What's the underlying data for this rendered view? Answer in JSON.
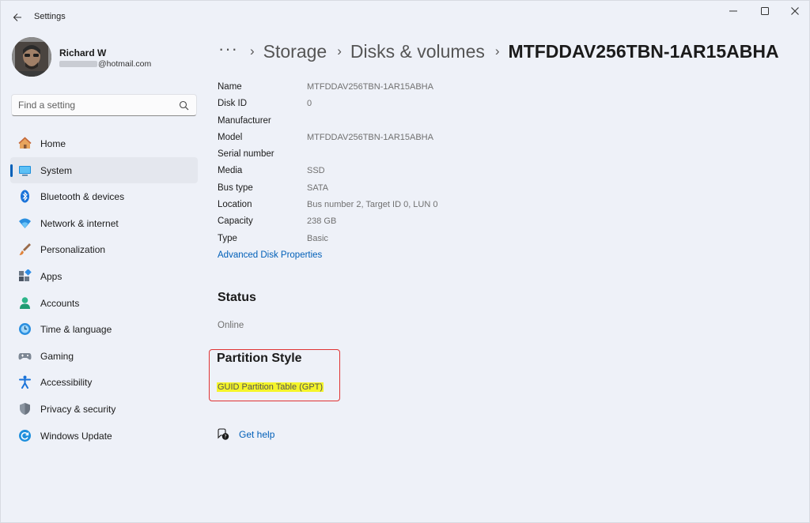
{
  "window": {
    "app_title": "Settings"
  },
  "user": {
    "name": "Richard W",
    "email_suffix": "@hotmail.com"
  },
  "search": {
    "placeholder": "Find a setting"
  },
  "sidebar": {
    "items": [
      {
        "label": "Home",
        "icon": "home-icon"
      },
      {
        "label": "System",
        "icon": "system-icon",
        "selected": true
      },
      {
        "label": "Bluetooth & devices",
        "icon": "bluetooth-icon"
      },
      {
        "label": "Network & internet",
        "icon": "wifi-icon"
      },
      {
        "label": "Personalization",
        "icon": "brush-icon"
      },
      {
        "label": "Apps",
        "icon": "apps-icon"
      },
      {
        "label": "Accounts",
        "icon": "accounts-icon"
      },
      {
        "label": "Time & language",
        "icon": "time-language-icon"
      },
      {
        "label": "Gaming",
        "icon": "gaming-icon"
      },
      {
        "label": "Accessibility",
        "icon": "accessibility-icon"
      },
      {
        "label": "Privacy & security",
        "icon": "shield-icon"
      },
      {
        "label": "Windows Update",
        "icon": "update-icon"
      }
    ]
  },
  "breadcrumb": {
    "more": "···",
    "items": [
      "Storage",
      "Disks & volumes"
    ],
    "current": "MTFDDAV256TBN-1AR15ABHA"
  },
  "properties": [
    {
      "key": "Name",
      "value": "MTFDDAV256TBN-1AR15ABHA"
    },
    {
      "key": "Disk ID",
      "value": "0"
    },
    {
      "key": "Manufacturer",
      "value": ""
    },
    {
      "key": "Model",
      "value": "MTFDDAV256TBN-1AR15ABHA"
    },
    {
      "key": "Serial number",
      "value": ""
    },
    {
      "key": "Media",
      "value": "SSD"
    },
    {
      "key": "Bus type",
      "value": "SATA"
    },
    {
      "key": "Location",
      "value": "Bus number 2, Target ID 0, LUN 0"
    },
    {
      "key": "Capacity",
      "value": "238 GB"
    },
    {
      "key": "Type",
      "value": "Basic"
    }
  ],
  "advanced_link": "Advanced Disk Properties",
  "status": {
    "heading": "Status",
    "value": "Online"
  },
  "partition_style": {
    "heading": "Partition Style",
    "value": "GUID Partition Table (GPT)"
  },
  "help": {
    "label": "Get help"
  },
  "colors": {
    "accent": "#005fb8",
    "highlight_border": "#e03333",
    "highlight_fill": "#f5f52a",
    "background": "#eef1f8"
  }
}
